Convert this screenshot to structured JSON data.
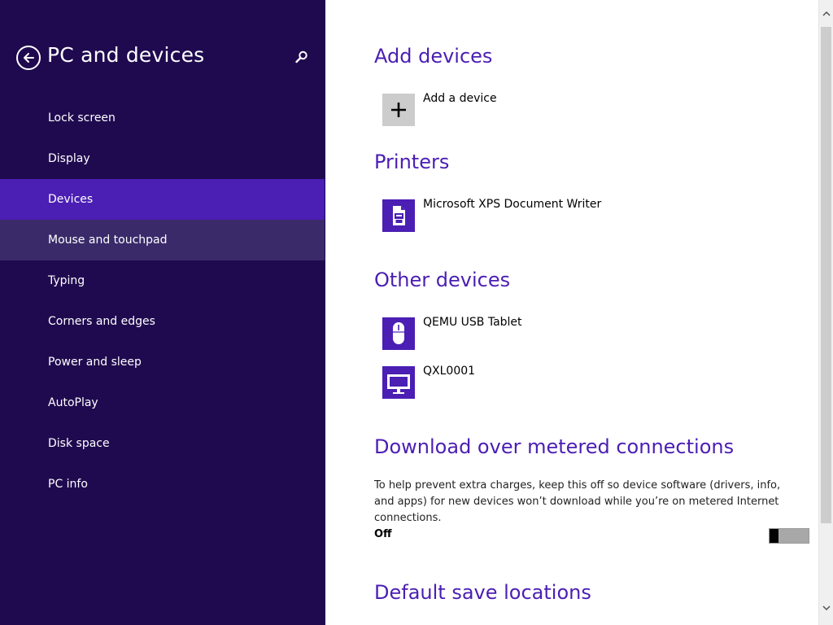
{
  "sidebar": {
    "title": "PC and devices",
    "items": [
      {
        "label": "Lock screen"
      },
      {
        "label": "Display"
      },
      {
        "label": "Devices"
      },
      {
        "label": "Mouse and touchpad"
      },
      {
        "label": "Typing"
      },
      {
        "label": "Corners and edges"
      },
      {
        "label": "Power and sleep"
      },
      {
        "label": "AutoPlay"
      },
      {
        "label": "Disk space"
      },
      {
        "label": "PC info"
      }
    ],
    "selected_item": "Devices",
    "hovered_item": "Mouse and touchpad",
    "colors": {
      "background": "#1f0a4f",
      "selected": "#4b1eb4",
      "hover": "#3a2a6a"
    }
  },
  "main": {
    "add_devices": {
      "title": "Add devices",
      "add_label": "Add a device"
    },
    "printers": {
      "title": "Printers",
      "devices": [
        {
          "label": "Microsoft XPS Document Writer",
          "icon": "printer-icon"
        }
      ]
    },
    "other_devices": {
      "title": "Other devices",
      "devices": [
        {
          "label": "QEMU USB Tablet",
          "icon": "mouse-icon"
        },
        {
          "label": "QXL0001",
          "icon": "monitor-icon"
        }
      ]
    },
    "metered": {
      "title": "Download over metered connections",
      "description": "To help prevent extra charges, keep this off so device software (drivers, info, and apps) for new devices won’t download while you’re on metered Internet connections.",
      "toggle_state": "Off"
    },
    "save_locations": {
      "title": "Default save locations"
    },
    "colors": {
      "accent": "#4b1eb4"
    }
  }
}
